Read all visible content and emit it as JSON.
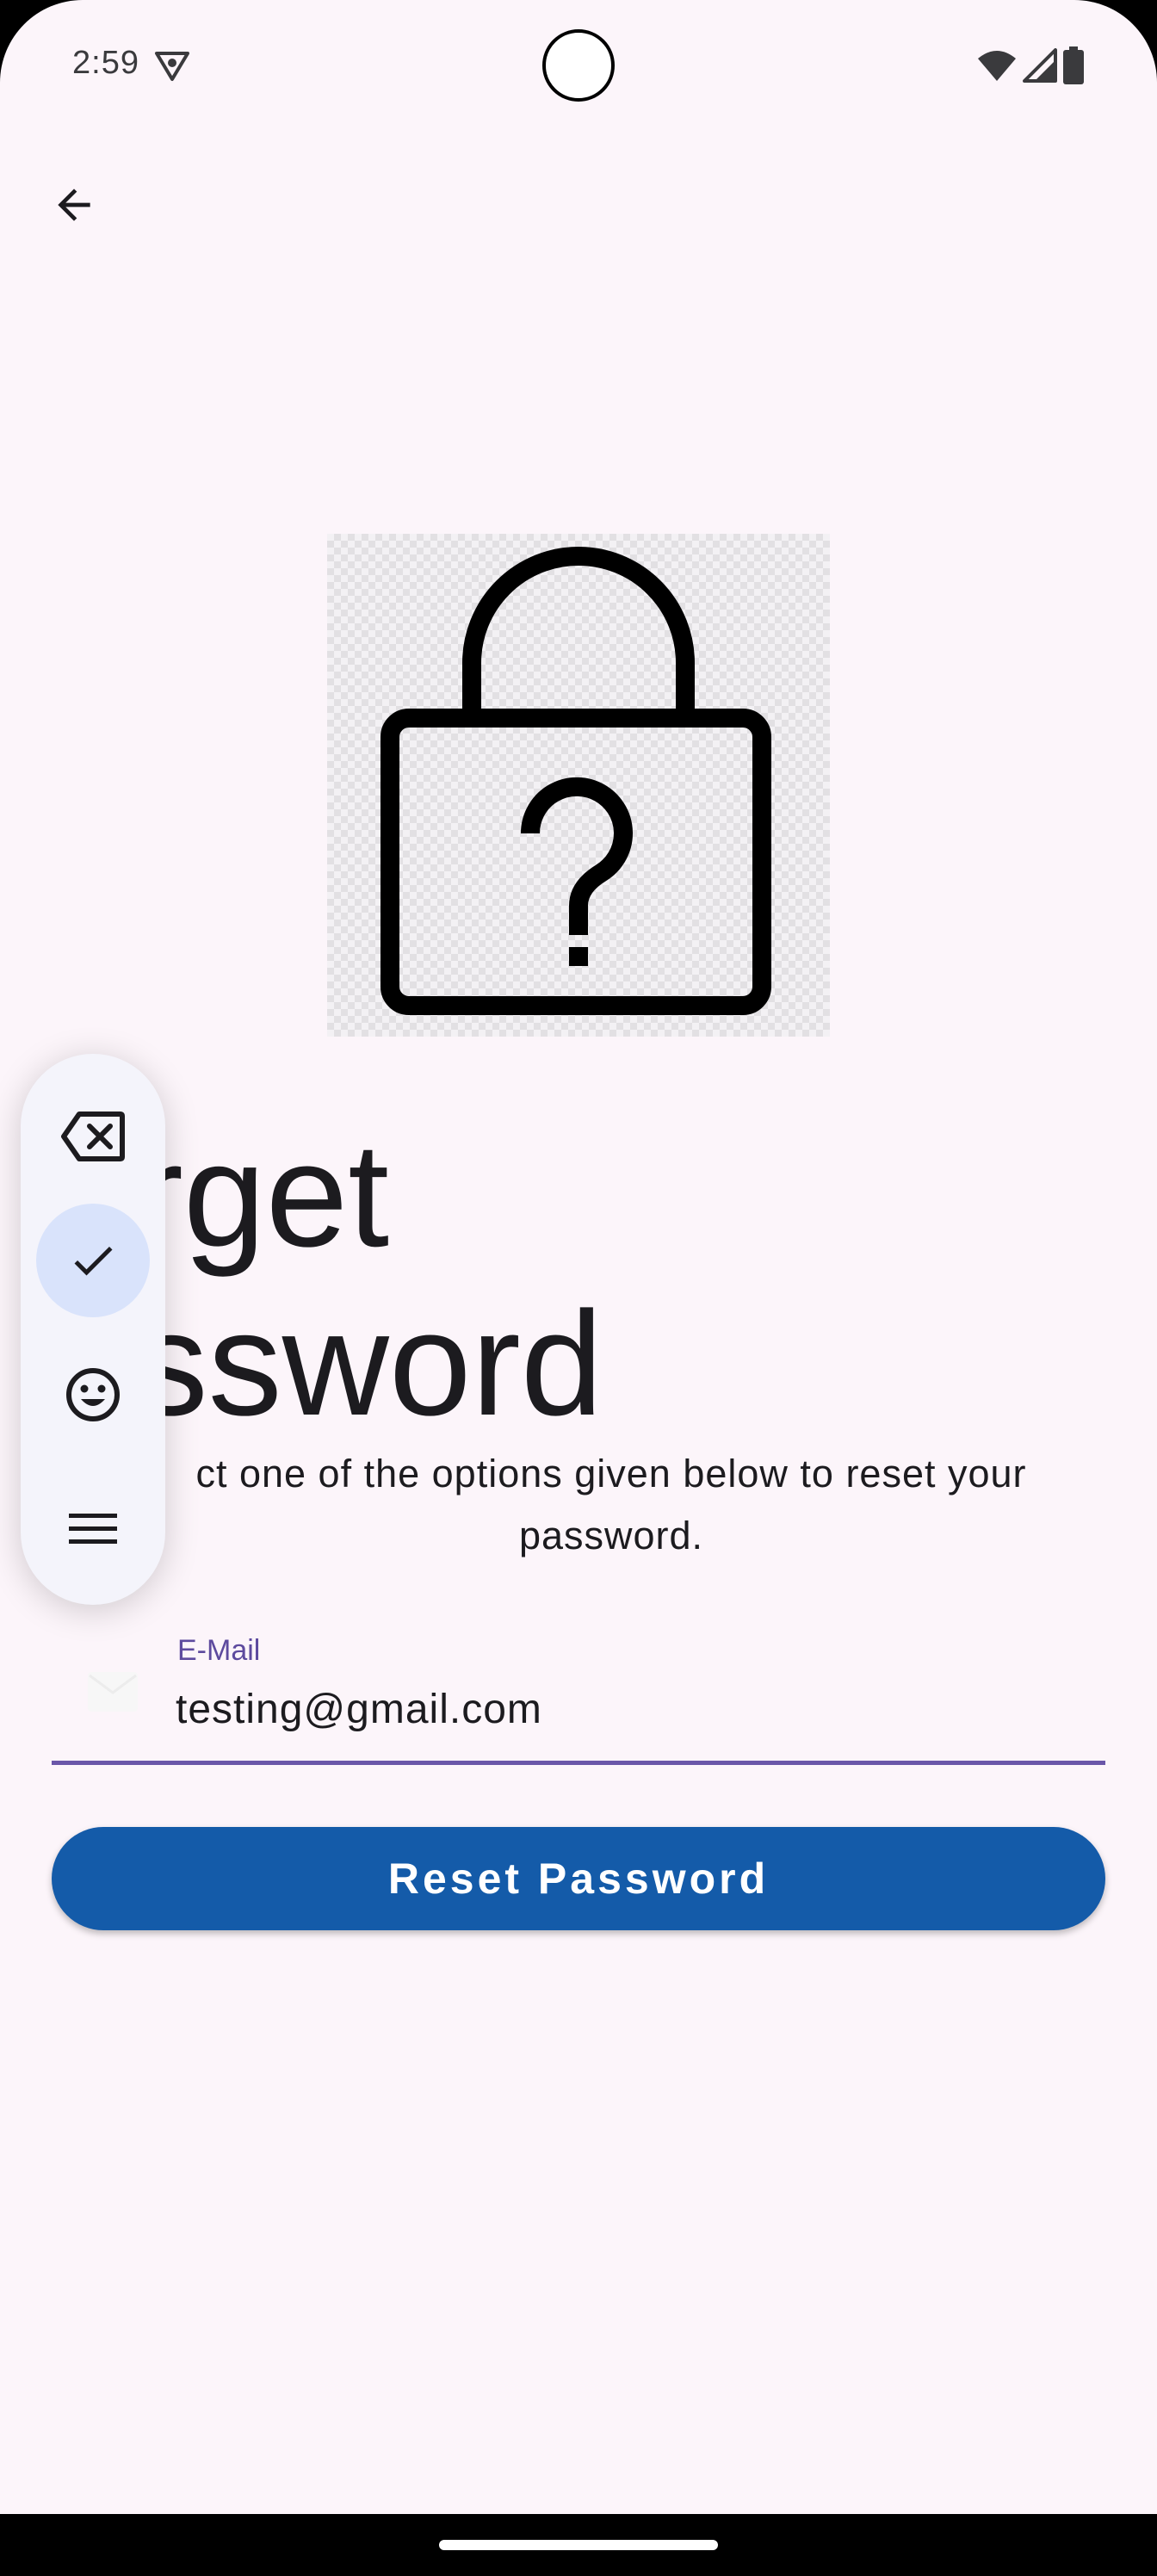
{
  "status_bar": {
    "time": "2:59",
    "icons": [
      "vpn-key-icon",
      "wifi-icon",
      "cell-signal-icon",
      "battery-icon"
    ]
  },
  "header": {
    "back_icon": "arrow-back-icon"
  },
  "hero": {
    "icon": "lock-question-icon"
  },
  "title": {
    "line1": "orget",
    "line2": "assword"
  },
  "subtitle": "ct one of the options given below to reset your password.",
  "email_field": {
    "label": "E-Mail",
    "value": "testing@gmail.com",
    "icon": "mail-icon"
  },
  "reset_button": {
    "label": "Reset Password"
  },
  "floating_toolbar": {
    "items": [
      "backspace-icon",
      "check-icon",
      "emoji-icon",
      "menu-icon"
    ]
  },
  "colors": {
    "background": "#fcf5fa",
    "primary_button": "#145ba9",
    "field_accent": "#6a56a8",
    "toolbar_active": "#d9e3fb"
  }
}
